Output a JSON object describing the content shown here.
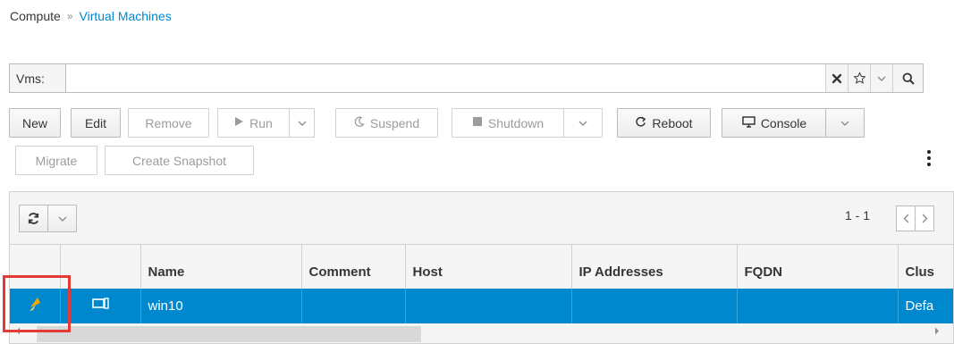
{
  "breadcrumb": {
    "section": "Compute",
    "separator": "»",
    "current": "Virtual Machines"
  },
  "search": {
    "label": "Vms:",
    "value": "",
    "placeholder": "",
    "clear_icon": "✖",
    "bookmark_icon": "☆",
    "dropdown_icon": "⌄",
    "search_icon": "🔍"
  },
  "actions": {
    "new": "New",
    "edit": "Edit",
    "remove": "Remove",
    "run": "Run",
    "suspend": "Suspend",
    "shutdown": "Shutdown",
    "reboot": "Reboot",
    "console": "Console",
    "migrate": "Migrate",
    "create_snapshot": "Create Snapshot"
  },
  "grid": {
    "pager": "1 - 1",
    "columns": [
      "",
      "",
      "Name",
      "Comment",
      "Host",
      "IP Addresses",
      "FQDN",
      "Clus"
    ],
    "rows": [
      {
        "status": "migrating",
        "type": "vm",
        "name": "win10",
        "comment": "",
        "host": "",
        "ip": "",
        "fqdn": "",
        "cluster": "Defa"
      }
    ]
  },
  "colors": {
    "accent": "#0088ce",
    "highlight": "#e53935"
  }
}
